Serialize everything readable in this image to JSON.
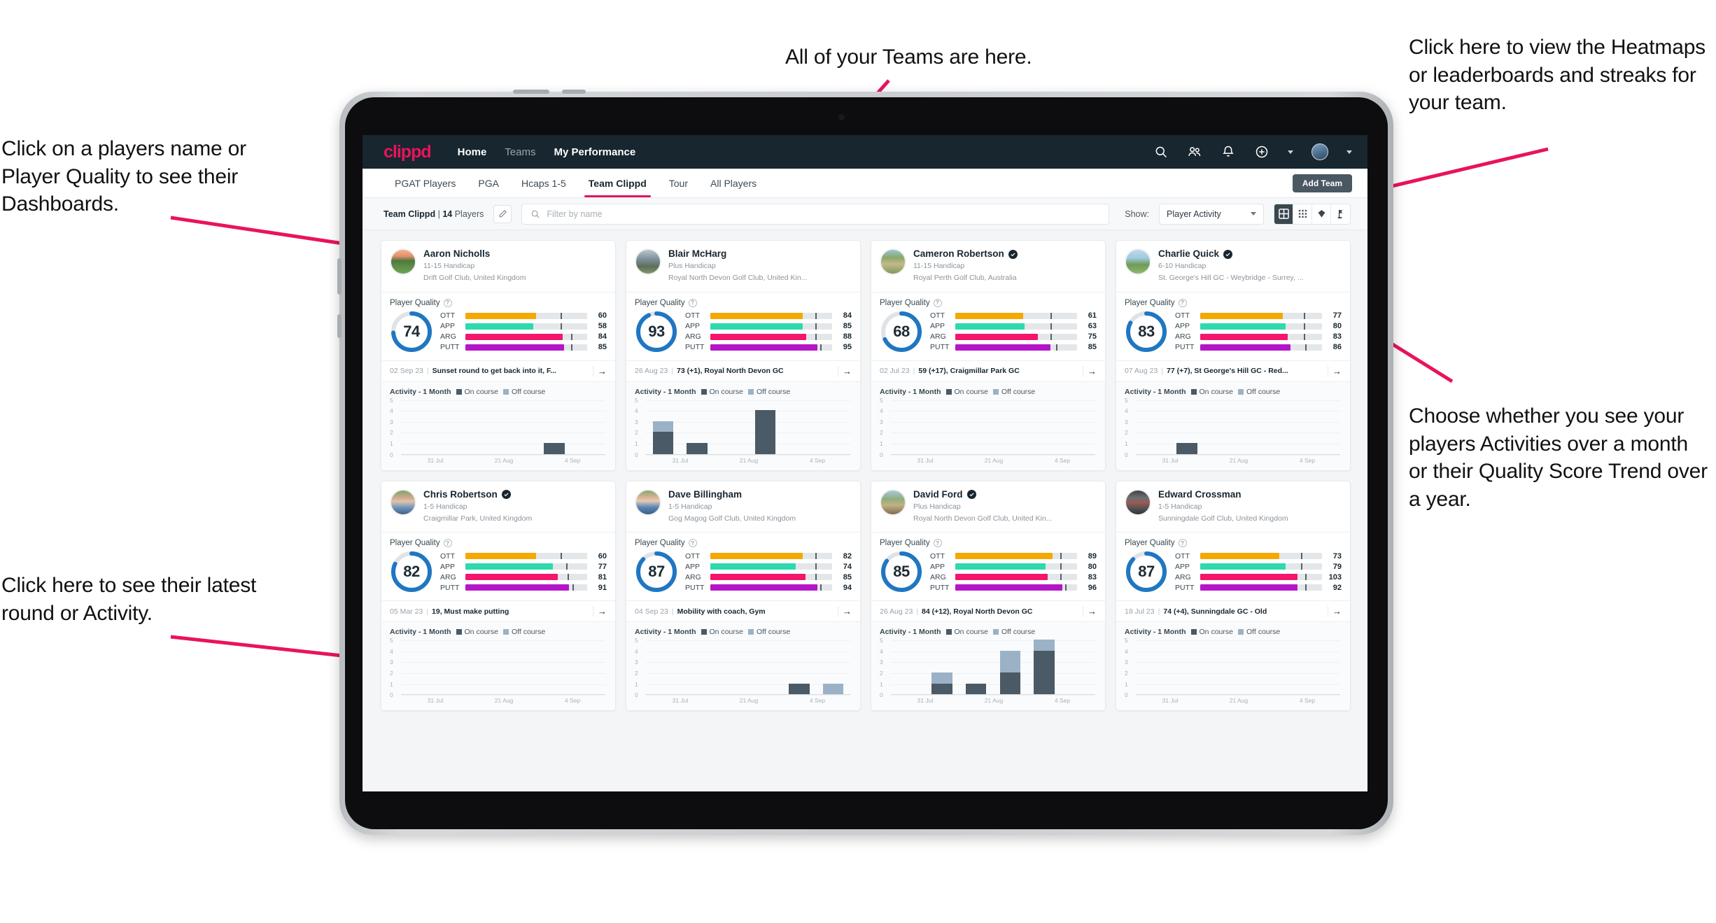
{
  "annotations": [
    {
      "id": "a-players-name",
      "text": "Click on a players name or Player Quality to see their Dashboards."
    },
    {
      "id": "a-teams",
      "text": "All of your Teams are here."
    },
    {
      "id": "a-heatmaps",
      "text": "Click here to view the Heatmaps or leaderboards and streaks for your team."
    },
    {
      "id": "a-activity-year",
      "text": "Choose whether you see your players Activities over a month or their Quality Score Trend over a year."
    },
    {
      "id": "a-latest-round",
      "text": "Click here to see their latest round or Activity."
    }
  ],
  "colors": {
    "brand": "#e8145b",
    "navbar": "#17262f",
    "ring": "#1f77c2",
    "ott": "#f5a800",
    "app": "#2ed9ad",
    "arg": "#f5156c",
    "putt": "#b515c9",
    "on_course": "#4a5a66",
    "off_course": "#9bb2c6"
  },
  "appbar": {
    "logo": "clippd",
    "links": [
      {
        "label": "Home",
        "active": true
      },
      {
        "label": "Teams",
        "active": false
      },
      {
        "label": "My Performance",
        "active": true
      }
    ],
    "icons": [
      "search-icon",
      "people-icon",
      "bell-icon",
      "add-circle-icon",
      "avatar"
    ]
  },
  "tabs": [
    {
      "label": "PGAT Players",
      "active": false
    },
    {
      "label": "PGA",
      "active": false
    },
    {
      "label": "Hcaps 1-5",
      "active": false
    },
    {
      "label": "Team Clippd",
      "active": true
    },
    {
      "label": "Tour",
      "active": false
    },
    {
      "label": "All Players",
      "active": false
    }
  ],
  "add_team_label": "Add Team",
  "toolbar": {
    "team_name": "Team Clippd",
    "separator": "|",
    "player_count": "14",
    "players_word": "Players",
    "edit_icon": "pencil-icon",
    "search_placeholder": "Filter by name",
    "search_value": "",
    "show_label": "Show:",
    "show_value": "Player Activity",
    "view_modes": [
      {
        "name": "grid-view-icon",
        "active": true
      },
      {
        "name": "dense-grid-view-icon",
        "active": false
      },
      {
        "name": "heatmap-view-icon",
        "active": false
      },
      {
        "name": "leaderboard-flag-view-icon",
        "active": false
      }
    ]
  },
  "card_labels": {
    "player_quality": "Player Quality",
    "help_icon": "help-circle-icon",
    "activity_title": "Activity - 1 Month",
    "legend_on": "On course",
    "legend_off": "Off course",
    "arrow": "→"
  },
  "chart_data": {
    "type": "bar",
    "title": "Activity - 1 Month",
    "ylabel": "",
    "xlabel": "",
    "ylim": [
      0,
      5
    ],
    "yticks": [
      0,
      1,
      2,
      3,
      4,
      5
    ],
    "grid": true,
    "legend": [
      "On course",
      "Off course"
    ],
    "legend_position": "top",
    "x_tick_labels": [
      "31 Jul",
      "21 Aug",
      "4 Sep"
    ],
    "bins": 6,
    "series_per_player": [
      {
        "player": "Aaron Nicholls",
        "on_course": [
          0,
          0,
          0,
          0,
          1,
          0
        ],
        "off_course": [
          0,
          0,
          0,
          0,
          0,
          0
        ]
      },
      {
        "player": "Blair McHarg",
        "on_course": [
          2,
          1,
          0,
          4,
          0,
          0
        ],
        "off_course": [
          1,
          0,
          0,
          0,
          0,
          0
        ]
      },
      {
        "player": "Cameron Robertson",
        "on_course": [
          0,
          0,
          0,
          0,
          0,
          0
        ],
        "off_course": [
          0,
          0,
          0,
          0,
          0,
          0
        ]
      },
      {
        "player": "Charlie Quick",
        "on_course": [
          0,
          1,
          0,
          0,
          0,
          0
        ],
        "off_course": [
          0,
          0,
          0,
          0,
          0,
          0
        ]
      },
      {
        "player": "Chris Robertson",
        "on_course": [
          0,
          0,
          0,
          0,
          0,
          0
        ],
        "off_course": [
          0,
          0,
          0,
          0,
          0,
          0
        ]
      },
      {
        "player": "Dave Billingham",
        "on_course": [
          0,
          0,
          0,
          0,
          1,
          0
        ],
        "off_course": [
          0,
          0,
          0,
          0,
          0,
          1
        ]
      },
      {
        "player": "David Ford",
        "on_course": [
          0,
          1,
          1,
          2,
          4,
          0
        ],
        "off_course": [
          0,
          1,
          0,
          2,
          1,
          0
        ]
      },
      {
        "player": "Edward Crossman",
        "on_course": [
          0,
          0,
          0,
          0,
          0,
          0
        ],
        "off_course": [
          0,
          0,
          0,
          0,
          0,
          0
        ]
      }
    ]
  },
  "players": [
    {
      "name": "Aaron Nicholls",
      "verified": false,
      "handicap": "11-15 Handicap",
      "club": "Drift Golf Club, United Kingdom",
      "quality": 74,
      "metrics": [
        {
          "key": "OTT",
          "value": 60,
          "fill": 58,
          "tick": 78
        },
        {
          "key": "APP",
          "value": 58,
          "fill": 56,
          "tick": 78
        },
        {
          "key": "ARG",
          "value": 84,
          "fill": 80,
          "tick": 87
        },
        {
          "key": "PUTT",
          "value": 85,
          "fill": 81,
          "tick": 87
        }
      ],
      "latest_date": "02 Sep 23",
      "latest_text": "Sunset round to get back into it, F..."
    },
    {
      "name": "Blair McHarg",
      "verified": false,
      "handicap": "Plus Handicap",
      "club": "Royal North Devon Golf Club, United Kin...",
      "quality": 93,
      "metrics": [
        {
          "key": "OTT",
          "value": 84,
          "fill": 76,
          "tick": 86
        },
        {
          "key": "APP",
          "value": 85,
          "fill": 76,
          "tick": 86
        },
        {
          "key": "ARG",
          "value": 88,
          "fill": 79,
          "tick": 86
        },
        {
          "key": "PUTT",
          "value": 95,
          "fill": 88,
          "tick": 90
        }
      ],
      "latest_date": "26 Aug 23",
      "latest_text": "73 (+1), Royal North Devon GC"
    },
    {
      "name": "Cameron Robertson",
      "verified": true,
      "handicap": "11-15 Handicap",
      "club": "Royal Perth Golf Club, Australia",
      "quality": 68,
      "metrics": [
        {
          "key": "OTT",
          "value": 61,
          "fill": 56,
          "tick": 78
        },
        {
          "key": "APP",
          "value": 63,
          "fill": 57,
          "tick": 78
        },
        {
          "key": "ARG",
          "value": 75,
          "fill": 68,
          "tick": 78
        },
        {
          "key": "PUTT",
          "value": 85,
          "fill": 78,
          "tick": 83
        }
      ],
      "latest_date": "02 Jul 23",
      "latest_text": "59 (+17), Craigmillar Park GC"
    },
    {
      "name": "Charlie Quick",
      "verified": true,
      "handicap": "6-10 Handicap",
      "club": "St. George's Hill GC - Weybridge - Surrey, ...",
      "quality": 83,
      "metrics": [
        {
          "key": "OTT",
          "value": 77,
          "fill": 68,
          "tick": 85
        },
        {
          "key": "APP",
          "value": 80,
          "fill": 70,
          "tick": 85
        },
        {
          "key": "ARG",
          "value": 83,
          "fill": 72,
          "tick": 85
        },
        {
          "key": "PUTT",
          "value": 86,
          "fill": 74,
          "tick": 86
        }
      ],
      "latest_date": "07 Aug 23",
      "latest_text": "77 (+7), St George's Hill GC - Red..."
    },
    {
      "name": "Chris Robertson",
      "verified": true,
      "handicap": "1-5 Handicap",
      "club": "Craigmillar Park, United Kingdom",
      "quality": 82,
      "metrics": [
        {
          "key": "OTT",
          "value": 60,
          "fill": 58,
          "tick": 78
        },
        {
          "key": "APP",
          "value": 77,
          "fill": 72,
          "tick": 83
        },
        {
          "key": "ARG",
          "value": 81,
          "fill": 76,
          "tick": 84
        },
        {
          "key": "PUTT",
          "value": 91,
          "fill": 85,
          "tick": 88
        }
      ],
      "latest_date": "05 Mar 23",
      "latest_text": "19, Must make putting"
    },
    {
      "name": "Dave Billingham",
      "verified": false,
      "handicap": "1-5 Handicap",
      "club": "Gog Magog Golf Club, United Kingdom",
      "quality": 87,
      "metrics": [
        {
          "key": "OTT",
          "value": 82,
          "fill": 76,
          "tick": 86
        },
        {
          "key": "APP",
          "value": 74,
          "fill": 70,
          "tick": 86
        },
        {
          "key": "ARG",
          "value": 85,
          "fill": 78,
          "tick": 86
        },
        {
          "key": "PUTT",
          "value": 94,
          "fill": 88,
          "tick": 90
        }
      ],
      "latest_date": "04 Sep 23",
      "latest_text": "Mobility with coach, Gym"
    },
    {
      "name": "David Ford",
      "verified": true,
      "handicap": "Plus Handicap",
      "club": "Royal North Devon Golf Club, United Kin...",
      "quality": 85,
      "metrics": [
        {
          "key": "OTT",
          "value": 89,
          "fill": 80,
          "tick": 86
        },
        {
          "key": "APP",
          "value": 80,
          "fill": 74,
          "tick": 86
        },
        {
          "key": "ARG",
          "value": 83,
          "fill": 76,
          "tick": 86
        },
        {
          "key": "PUTT",
          "value": 96,
          "fill": 88,
          "tick": 90
        }
      ],
      "latest_date": "26 Aug 23",
      "latest_text": "84 (+12), Royal North Devon GC"
    },
    {
      "name": "Edward Crossman",
      "verified": false,
      "handicap": "1-5 Handicap",
      "club": "Sunningdale Golf Club, United Kingdom",
      "quality": 87,
      "metrics": [
        {
          "key": "OTT",
          "value": 73,
          "fill": 65,
          "tick": 83
        },
        {
          "key": "APP",
          "value": 79,
          "fill": 70,
          "tick": 83
        },
        {
          "key": "ARG",
          "value": 103,
          "fill": 80,
          "tick": 86
        },
        {
          "key": "PUTT",
          "value": 92,
          "fill": 80,
          "tick": 86
        }
      ],
      "latest_date": "18 Jul 23",
      "latest_text": "74 (+4), Sunningdale GC - Old"
    }
  ]
}
